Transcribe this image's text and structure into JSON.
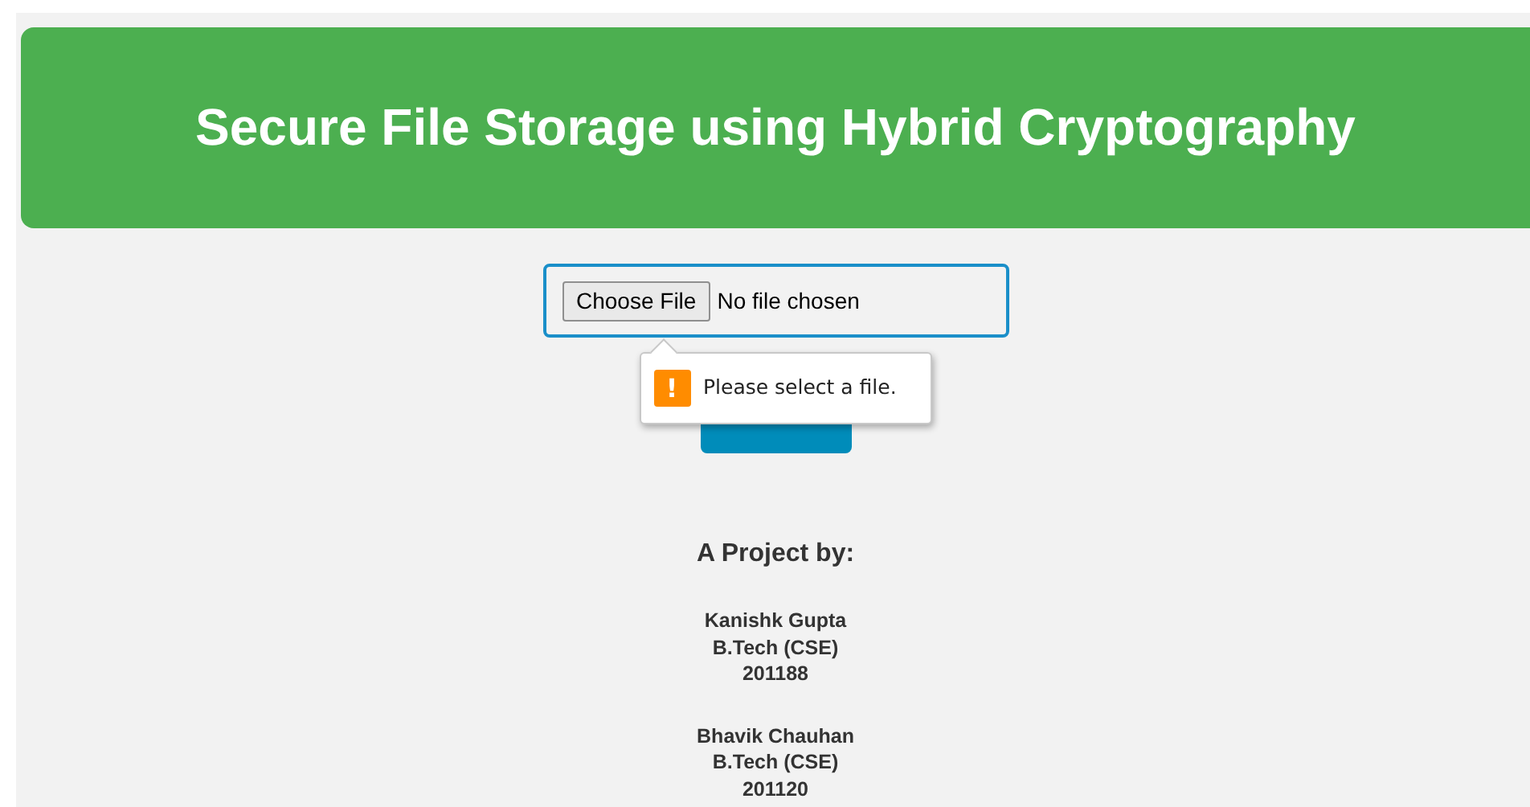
{
  "header": {
    "title": "Secure File Storage using Hybrid Cryptography"
  },
  "upload": {
    "button": "Choose File",
    "status": "No file chosen",
    "focused": true
  },
  "tooltip": {
    "message": "Please select a file.",
    "icon": "!"
  },
  "submit": {
    "kind": "button"
  },
  "credits": {
    "heading": "A Project by:",
    "members": [
      {
        "name": "Kanishk Gupta",
        "program": "B.Tech (CSE)",
        "id": "201188"
      },
      {
        "name": "Bhavik Chauhan",
        "program": "B.Tech (CSE)",
        "id": "201120"
      }
    ]
  }
}
